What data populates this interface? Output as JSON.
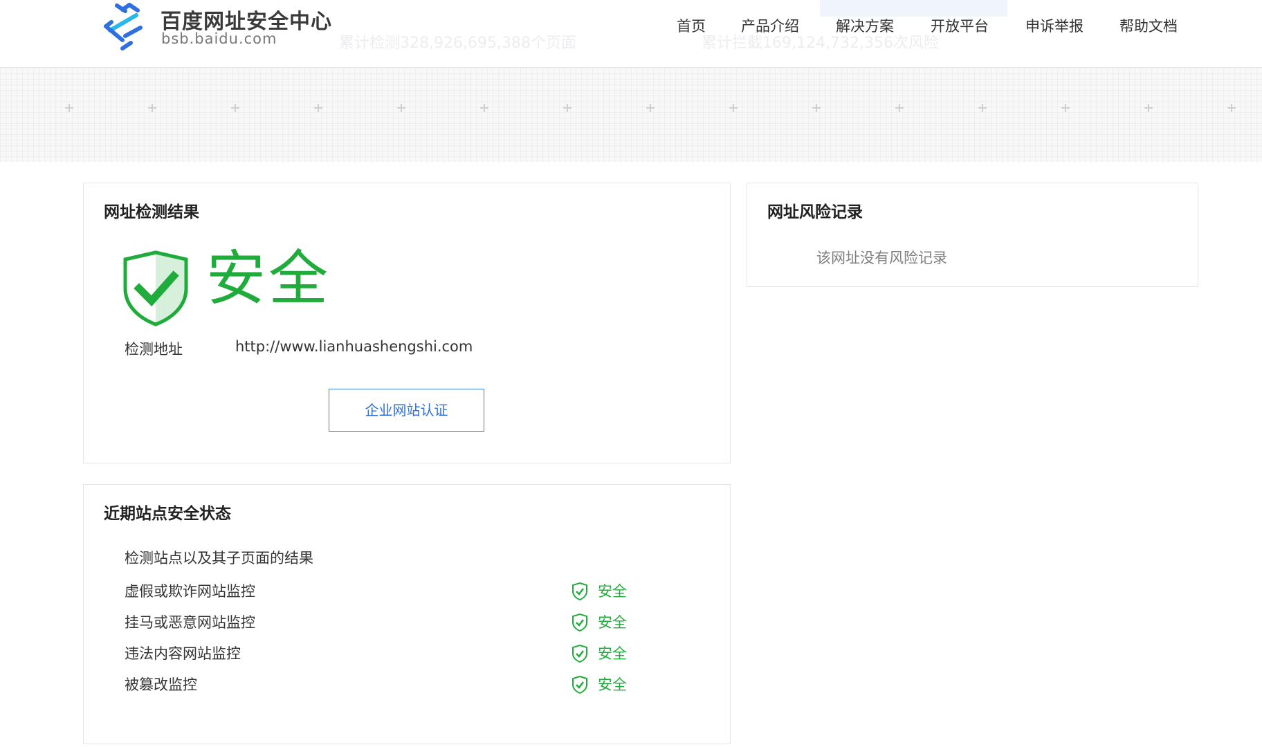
{
  "header": {
    "logo_title": "百度网址安全中心",
    "logo_subtitle": "bsb.baidu.com",
    "stat_pages": "累计检测328,926,695,388个页面",
    "stat_risks": "累计拦截169,124,732,356次风险",
    "nav": [
      {
        "label": "首页"
      },
      {
        "label": "产品介绍"
      },
      {
        "label": "解决方案"
      },
      {
        "label": "开放平台"
      },
      {
        "label": "申诉举报"
      },
      {
        "label": "帮助文档"
      }
    ]
  },
  "result": {
    "title": "网址检测结果",
    "status": "安全",
    "url_label": "检测地址",
    "url_value": "http://www.lianhuashengshi.com",
    "verify_button": "企业网站认证"
  },
  "risk": {
    "title": "网址风险记录",
    "empty_text": "该网址没有风险记录"
  },
  "site_status": {
    "title": "近期站点安全状态",
    "intro": "检测站点以及其子页面的结果",
    "rows": [
      {
        "label": "虚假或欺诈网站监控",
        "value": "安全"
      },
      {
        "label": "挂马或恶意网站监控",
        "value": "安全"
      },
      {
        "label": "违法内容网站监控",
        "value": "安全"
      },
      {
        "label": "被篡改监控",
        "value": "安全"
      }
    ]
  },
  "icons": {
    "logo": "baidu-safety-logo-icon",
    "shield": "shield-check-icon"
  },
  "colors": {
    "safe_green": "#1fac3b",
    "link_blue": "#2d6fde",
    "logo_blue": "#2f6fe0"
  }
}
